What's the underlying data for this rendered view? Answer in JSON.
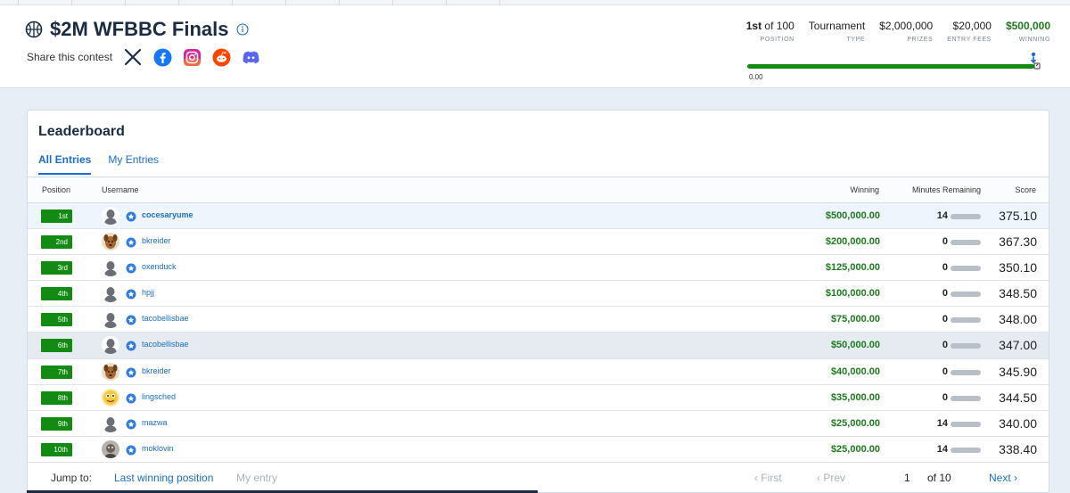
{
  "header": {
    "title": "$2M WFBBC Finals",
    "share_label": "Share this contest",
    "social_icons": [
      "x-icon",
      "facebook-icon",
      "instagram-icon",
      "reddit-icon",
      "discord-icon"
    ],
    "stats": {
      "position_rank": "1st",
      "position_of": "of 100",
      "position_label": "POSITION",
      "type_value": "Tournament",
      "type_label": "TYPE",
      "prizes_value": "$2,000,000",
      "prizes_label": "PRIZES",
      "entry_fees_value": "$20,000",
      "entry_fees_label": "ENTRY FEES",
      "winning_value": "$500,000",
      "winning_label": "WINNING"
    },
    "progress_start_label": "0.00",
    "progress_fraction": 1.0
  },
  "leaderboard": {
    "title": "Leaderboard",
    "tabs": [
      {
        "label": "All Entries",
        "active": true
      },
      {
        "label": "My Entries",
        "active": false
      }
    ],
    "columns": {
      "position": "Position",
      "username": "Username",
      "winning": "Winning",
      "minutes": "Minutes Remaining",
      "score": "Score"
    },
    "rows": [
      {
        "position": "1st",
        "avatar": "default",
        "username": "cocesaryume",
        "winning": "$500,000.00",
        "minutes": "14",
        "score": "375.10"
      },
      {
        "position": "2nd",
        "avatar": "dog",
        "username": "bkreider",
        "winning": "$200,000.00",
        "minutes": "0",
        "score": "367.30"
      },
      {
        "position": "3rd",
        "avatar": "default",
        "username": "oxenduck",
        "winning": "$125,000.00",
        "minutes": "0",
        "score": "350.10"
      },
      {
        "position": "4th",
        "avatar": "default",
        "username": "hpjj",
        "winning": "$100,000.00",
        "minutes": "0",
        "score": "348.50"
      },
      {
        "position": "5th",
        "avatar": "default",
        "username": "tacobellisbae",
        "winning": "$75,000.00",
        "minutes": "0",
        "score": "348.00"
      },
      {
        "position": "6th",
        "avatar": "default",
        "username": "tacobellisbae",
        "winning": "$50,000.00",
        "minutes": "0",
        "score": "347.00"
      },
      {
        "position": "7th",
        "avatar": "dog",
        "username": "bkreider",
        "winning": "$40,000.00",
        "minutes": "0",
        "score": "345.90"
      },
      {
        "position": "8th",
        "avatar": "cartoon",
        "username": "lingsched",
        "winning": "$35,000.00",
        "minutes": "0",
        "score": "344.50"
      },
      {
        "position": "9th",
        "avatar": "default",
        "username": "mazwa",
        "winning": "$25,000.00",
        "minutes": "14",
        "score": "340.00"
      },
      {
        "position": "10th",
        "avatar": "photo",
        "username": "moklovin",
        "winning": "$25,000.00",
        "minutes": "14",
        "score": "338.40"
      }
    ]
  },
  "footer": {
    "jump_to_label": "Jump to:",
    "last_winning_label": "Last winning position",
    "my_entry_label": "My entry",
    "first_label": "‹ First",
    "prev_label": "‹ Prev",
    "page_number": "1",
    "page_of": "of 10",
    "next_label": "Next ›"
  },
  "colors": {
    "accent_blue": "#1a6dcc",
    "position_green": "#138a13",
    "winning_green": "#1d7a1d",
    "title_navy": "#1b2b44"
  }
}
